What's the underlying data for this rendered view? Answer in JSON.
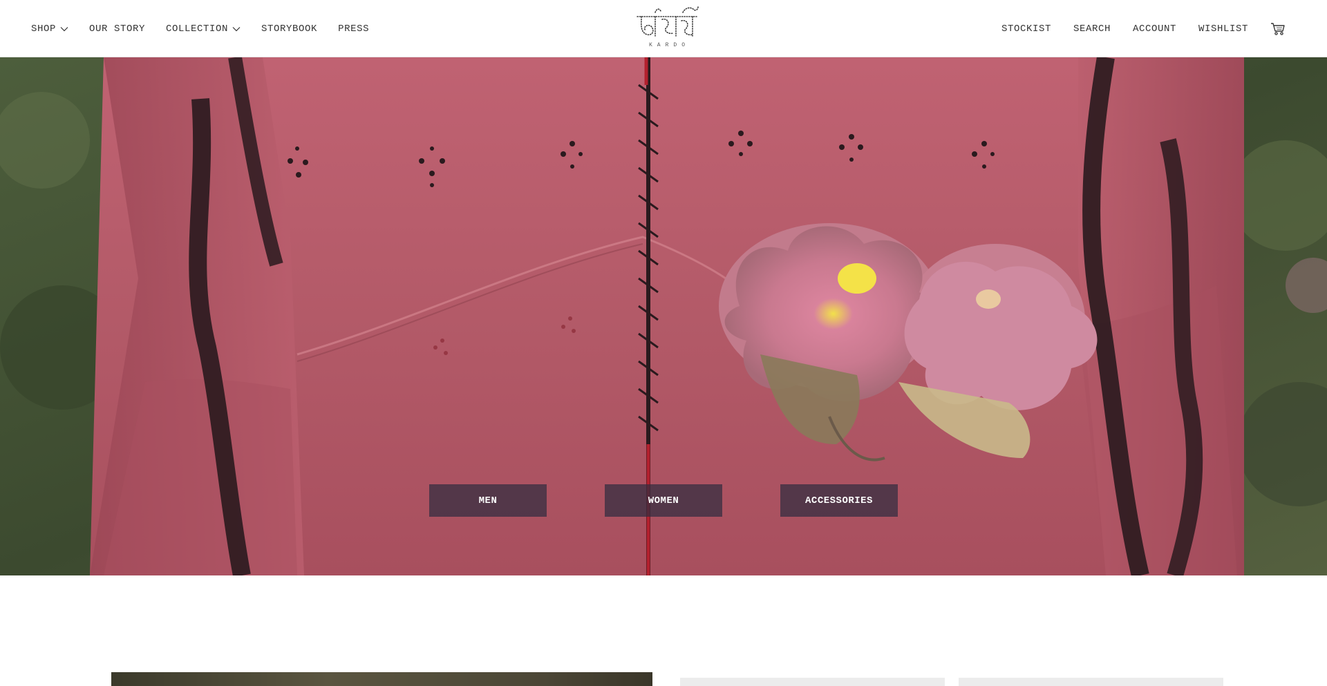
{
  "header": {
    "nav_left": [
      {
        "label": "SHOP",
        "has_dropdown": true
      },
      {
        "label": "OUR STORY",
        "has_dropdown": false
      },
      {
        "label": "COLLECTION",
        "has_dropdown": true
      },
      {
        "label": "STORYBOOK",
        "has_dropdown": false
      },
      {
        "label": "PRESS",
        "has_dropdown": false
      }
    ],
    "logo": {
      "script_text": "কার্দো",
      "wordmark": "KARDO"
    },
    "nav_right": [
      {
        "label": "STOCKIST"
      },
      {
        "label": "SEARCH"
      },
      {
        "label": "ACCOUNT"
      },
      {
        "label": "WISHLIST"
      }
    ],
    "cart_icon": "cart-icon"
  },
  "hero": {
    "image_subject": "pink handwoven jacket with lotus flowers",
    "buttons": [
      {
        "label": "MEN"
      },
      {
        "label": "WOMEN"
      },
      {
        "label": "ACCESSORIES"
      }
    ]
  },
  "colors": {
    "jacket": "#b55a68",
    "button_bg": "#302c40",
    "foliage": "#4a5a38"
  }
}
